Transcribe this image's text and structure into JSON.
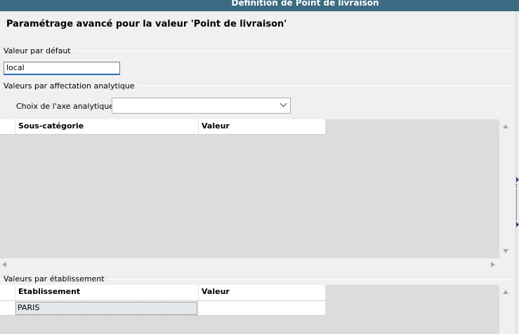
{
  "window": {
    "title": "Définition de Point de livraison"
  },
  "header": {
    "title": "Paramétrage avancé pour la valeur 'Point de livraison'"
  },
  "default_value": {
    "group_label": "Valeur par défaut",
    "value": "local"
  },
  "analytic": {
    "group_label": "Valeurs par affectation analytique",
    "axis_label": "Choix de l'axe analytique :",
    "axis_value": "",
    "columns": [
      "Sous-catégorie",
      "Valeur"
    ]
  },
  "establishment": {
    "group_label": "Valeurs par établissement",
    "columns": [
      "Etablissement",
      "Valeur"
    ],
    "rows": [
      {
        "etablissement": "PARIS",
        "valeur": ""
      }
    ]
  },
  "colors": {
    "titlebar": "#3c6a82",
    "grid_bg": "#dcdcdc",
    "input_focus": "#2a6ab4"
  }
}
